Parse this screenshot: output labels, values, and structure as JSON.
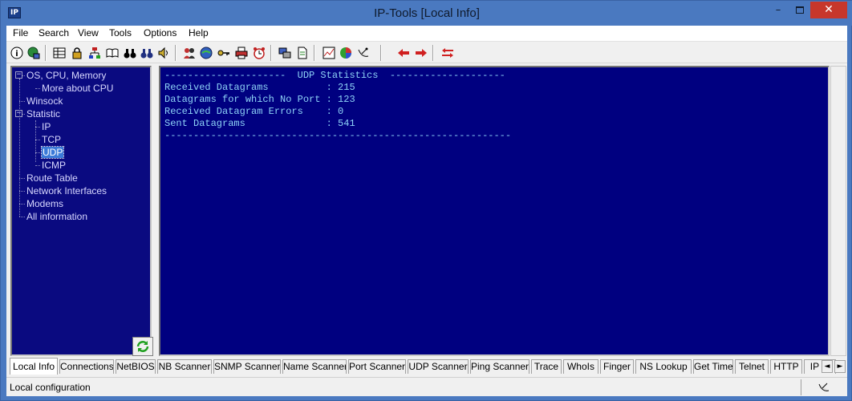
{
  "window": {
    "title": "IP-Tools [Local Info]",
    "icon_text": "IP",
    "minimize_glyph": "–",
    "close_glyph": "✕"
  },
  "menu": [
    "File",
    "Search",
    "View",
    "Tools",
    "Options",
    "Help"
  ],
  "toolbar": {
    "groups": [
      [
        "info-icon",
        "globe-computer-icon"
      ],
      [
        "table-icon",
        "lock-icon",
        "network-tree-icon",
        "book-icon",
        "binoculars-icon",
        "binoculars-alt-icon",
        "speaker-icon"
      ],
      [
        "people-icon",
        "globe-refresh-icon",
        "key-icon",
        "printer-icon",
        "alarm-clock-icon"
      ],
      [
        "computers-icon",
        "document-icon"
      ],
      [
        "graph-icon",
        "pie-chart-icon",
        "satellite-dish-icon"
      ],
      [
        "arrow-left-icon",
        "arrow-right-icon"
      ],
      [
        "swap-arrows-icon"
      ]
    ]
  },
  "tree": {
    "items": [
      {
        "label": "OS, CPU, Memory",
        "level": 0,
        "expander": "−"
      },
      {
        "label": "More about CPU",
        "level": 1
      },
      {
        "label": "Winsock",
        "level": 0
      },
      {
        "label": "Statistic",
        "level": 0,
        "expander": "−"
      },
      {
        "label": "IP",
        "level": 1
      },
      {
        "label": "TCP",
        "level": 1
      },
      {
        "label": "UDP",
        "level": 1,
        "selected": true
      },
      {
        "label": "ICMP",
        "level": 1
      },
      {
        "label": "Route Table",
        "level": 0
      },
      {
        "label": "Network Interfaces",
        "level": 0
      },
      {
        "label": "Modems",
        "level": 0
      },
      {
        "label": "All information",
        "level": 0
      }
    ]
  },
  "content": {
    "lines": [
      "---------------------  UDP Statistics  --------------------",
      "Received Datagrams          : 215",
      "Datagrams for which No Port : 123",
      "Received Datagram Errors    : 0",
      "Sent Datagrams              : 541",
      "------------------------------------------------------------"
    ]
  },
  "tabs": {
    "items": [
      "Local Info",
      "Connections",
      "NetBIOS",
      "NB Scanner",
      "SNMP Scanner",
      "Name Scanner",
      "Port Scanner",
      "UDP Scanner",
      "Ping Scanner",
      "Trace",
      "WhoIs",
      "Finger",
      "NS Lookup",
      "Get Time",
      "Telnet",
      "HTTP",
      "IP M"
    ],
    "active": "Local Info",
    "scroll_left": "◄",
    "scroll_right": "►"
  },
  "status": {
    "text": "Local configuration"
  },
  "colors": {
    "title_bar": "#4a79c0",
    "tree_bg": "#0a0a80",
    "content_bg": "#000080",
    "content_text": "#8ed3f7",
    "selection": "#3b7ad8"
  }
}
